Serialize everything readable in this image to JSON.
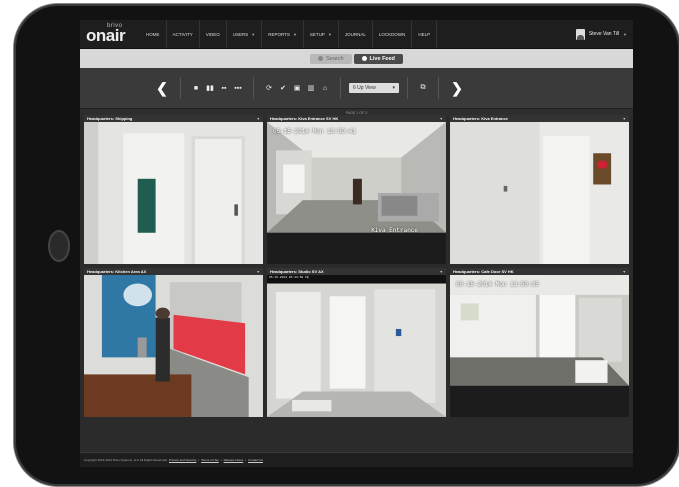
{
  "app": {
    "logo_small": "brivo",
    "logo_large": "onair"
  },
  "nav": {
    "items": [
      {
        "label": "HOME",
        "dropdown": false
      },
      {
        "label": "ACTIVITY",
        "dropdown": false
      },
      {
        "label": "VIDEO",
        "dropdown": false
      },
      {
        "label": "USERS",
        "dropdown": true
      },
      {
        "label": "REPORTS",
        "dropdown": true
      },
      {
        "label": "SETUP",
        "dropdown": true
      },
      {
        "label": "JOURNAL",
        "dropdown": false
      },
      {
        "label": "LOCKDOWN",
        "dropdown": false
      },
      {
        "label": "HELP",
        "dropdown": false
      }
    ],
    "user_name": "Steve Van Till"
  },
  "modes": {
    "search_label": "Search",
    "live_label": "Live Feed",
    "active": "Live Feed"
  },
  "toolbar": {
    "view_select": "6 Up View"
  },
  "page_indicator": "PAGE 1 OF 3",
  "cameras": [
    {
      "title": "Headquarters: Shipping"
    },
    {
      "title": "Headquarters: Kiva Entrance SV HK",
      "timestamp": "05-15-2014 Mon 13:50:41",
      "overlay_label": "Kiva Entrance"
    },
    {
      "title": "Headquarters: Kiva Entrance"
    },
    {
      "title": "Headquarters: Kitchen Area AX"
    },
    {
      "title": "Headquarters: Studio SV AX",
      "timestamp": "05-15-2014 05:13:50 IQ"
    },
    {
      "title": "Headquarters: Cafe Door SV HK",
      "timestamp": "05-15-2014 Mon 13:50:35"
    }
  ],
  "footer": {
    "copyright": "Copyright 2001-2014 Brivo Systems, LLC All Rights Reserved",
    "links": [
      "Privacy and Security",
      "Terms of Use",
      "Release Notes",
      "Contact Us"
    ]
  }
}
